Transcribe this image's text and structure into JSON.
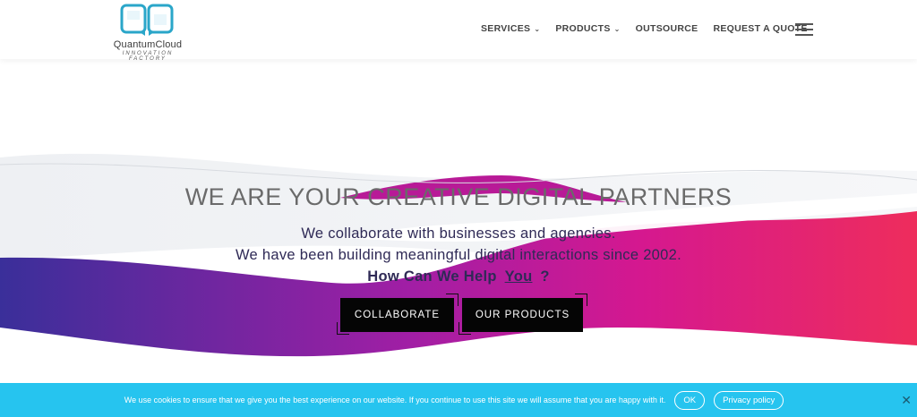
{
  "brand": {
    "name": "QuantumCloud",
    "tagline": "INNOVATION  FACTORY",
    "colors": {
      "logo_teal": "#2aa6c9",
      "nav_text": "#444444"
    }
  },
  "nav": {
    "items": [
      {
        "label": "SERVICES",
        "has_dropdown": true
      },
      {
        "label": "PRODUCTS",
        "has_dropdown": true
      },
      {
        "label": "OUTSOURCE",
        "has_dropdown": false
      },
      {
        "label": "REQUEST A QUOTE",
        "has_dropdown": false
      }
    ],
    "menu_icon": "hamburger-icon",
    "dropdown_icon": "chevron-down-icon"
  },
  "hero": {
    "title": "WE ARE YOUR CREATIVE DIGITAL PARTNERS",
    "line1": "We collaborate with businesses and agencies.",
    "line2": "We have been building meaningful digital interactions since 2002.",
    "question_prefix": "How Can We Help",
    "question_highlight": "You",
    "question_suffix": "?",
    "buttons": {
      "collaborate": "COLLABORATE",
      "products": "OUR PRODUCTS"
    },
    "colors": {
      "wave_start": "#3a2f9a",
      "wave_mid": "#c0189a",
      "wave_end": "#ee2d5c",
      "button_bg": "#050505"
    }
  },
  "cookie_bar": {
    "text": "We use cookies to ensure that we give you the best experience on our website. If you continue to use this site we will assume that you are happy with it.",
    "ok_label": "OK",
    "privacy_label": "Privacy policy",
    "close_glyph": "✕",
    "bg_color": "#26c4ef"
  }
}
